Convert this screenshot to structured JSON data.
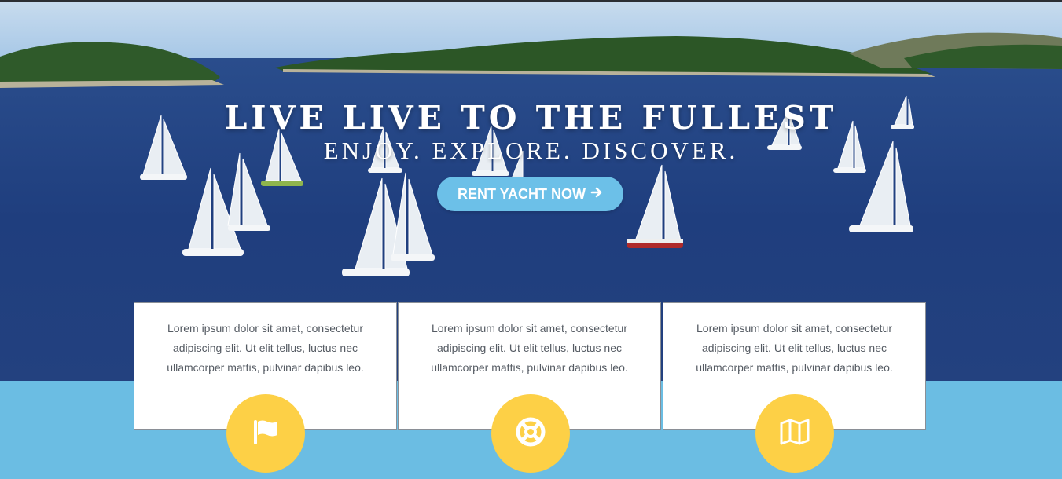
{
  "hero": {
    "headline": "LIVE LIVE TO THE FULLEST",
    "subheadline": "ENJOY. EXPLORE. DISCOVER.",
    "cta_label": "RENT YACHT NOW",
    "cta_icon": "arrow-right-icon"
  },
  "features": [
    {
      "text": "Lorem ipsum dolor sit amet, consectetur adipiscing elit. Ut elit tellus, luctus nec ullamcorper mattis, pulvinar dapibus leo.",
      "icon": "flag-icon"
    },
    {
      "text": "Lorem ipsum dolor sit amet, consectetur adipiscing elit. Ut elit tellus, luctus nec ullamcorper mattis, pulvinar dapibus leo.",
      "icon": "life-ring-icon"
    },
    {
      "text": "Lorem ipsum dolor sit amet, consectetur adipiscing elit. Ut elit tellus, luctus nec ullamcorper mattis, pulvinar dapibus leo.",
      "icon": "map-icon"
    }
  ],
  "colors": {
    "accent_blue": "#6cc0e8",
    "section_blue": "#6bbde3",
    "badge_yellow": "#fdd046",
    "sea": "#1f3d7c"
  }
}
